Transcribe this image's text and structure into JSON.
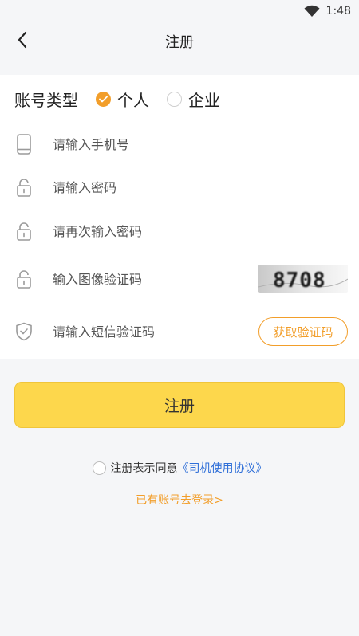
{
  "status_bar": {
    "time": "1:48"
  },
  "header": {
    "title": "注册"
  },
  "account_type": {
    "label": "账号类型",
    "options": [
      {
        "label": "个人",
        "checked": true
      },
      {
        "label": "企业",
        "checked": false
      }
    ]
  },
  "fields": {
    "phone": {
      "placeholder": "请输入手机号",
      "value": ""
    },
    "password": {
      "placeholder": "请输入密码",
      "value": ""
    },
    "confirm_password": {
      "placeholder": "请再次输入密码",
      "value": ""
    },
    "captcha": {
      "placeholder": "输入图像验证码",
      "value": "",
      "image_text": "8708"
    },
    "sms_code": {
      "placeholder": "请输入短信验证码",
      "value": "",
      "button_label": "获取验证码"
    }
  },
  "register_button": {
    "label": "注册"
  },
  "agreement": {
    "text": "注册表示同意",
    "link": "《司机使用协议》",
    "checked": false
  },
  "login_link": {
    "label": "已有账号去登录>"
  },
  "colors": {
    "accent": "#f29e2a",
    "button_bg": "#fdd74c",
    "link": "#2f6fd8",
    "background": "#f5f6f8"
  }
}
